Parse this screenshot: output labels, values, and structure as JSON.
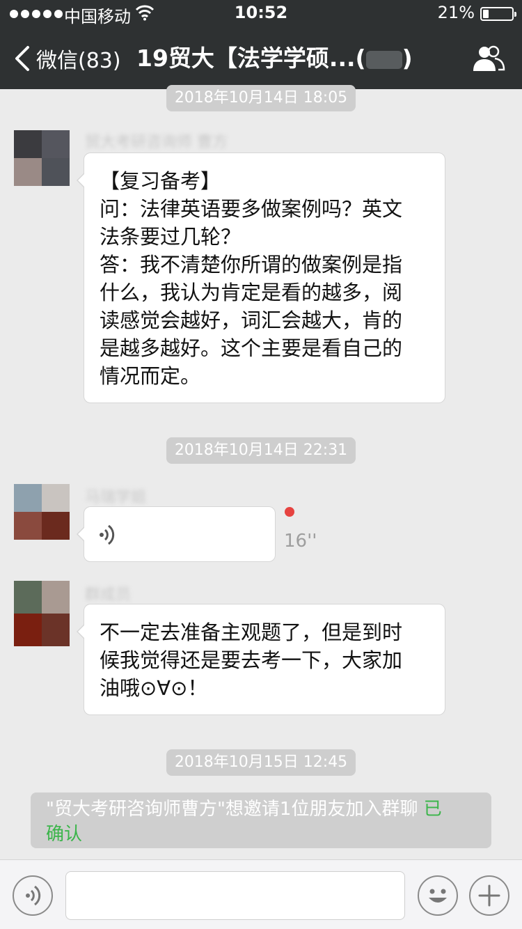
{
  "status_bar": {
    "carrier": "中国移动",
    "time": "10:52",
    "battery_percent_label": "21%",
    "battery_level": 0.21
  },
  "nav": {
    "back_label": "微信(83)",
    "title": "19贸大【法学学硕...(",
    "title_end": ")"
  },
  "messages": [
    {
      "time": "2018年10月14日 18:05",
      "sender": "贸大考研咨询师 曹方",
      "lines": [
        "【复习备考】",
        "问：法律英语要多做案例吗？英文",
        "法条要过几轮？",
        "答：我不清楚你所谓的做案例是指",
        "什么，我认为肯定是看的越多，阅",
        "读感觉会越好，词汇会越大，肯的",
        "是越多越好。这个主要是看自己的",
        "情况而定。"
      ]
    },
    {
      "time": "2018年10月14日 22:31",
      "sender": "马瑞学姐",
      "voice_duration": "16''"
    },
    {
      "sender": "群成员",
      "lines": [
        "不一定去准备主观题了，但是到时",
        "候我觉得还是要去考一下，大家加",
        "油哦⊙∀⊙！"
      ]
    }
  ],
  "system": {
    "time": "2018年10月15日 12:45",
    "text_line1": "\"贸大考研咨询师曹方\"想邀请1位朋友加入群聊",
    "confirm_1": "已",
    "confirm_2": "确认"
  },
  "input": {
    "value": ""
  },
  "colors": {
    "nav_bg": "#2e3132",
    "chat_bg": "#ebebeb",
    "time_pill": "#cecece",
    "confirm_green": "#3bb54a",
    "unread_red": "#e64340"
  },
  "icons": [
    "chevron-left-icon",
    "wifi-icon",
    "battery-icon",
    "group-members-icon",
    "voice-icon",
    "emoji-icon",
    "plus-icon"
  ]
}
